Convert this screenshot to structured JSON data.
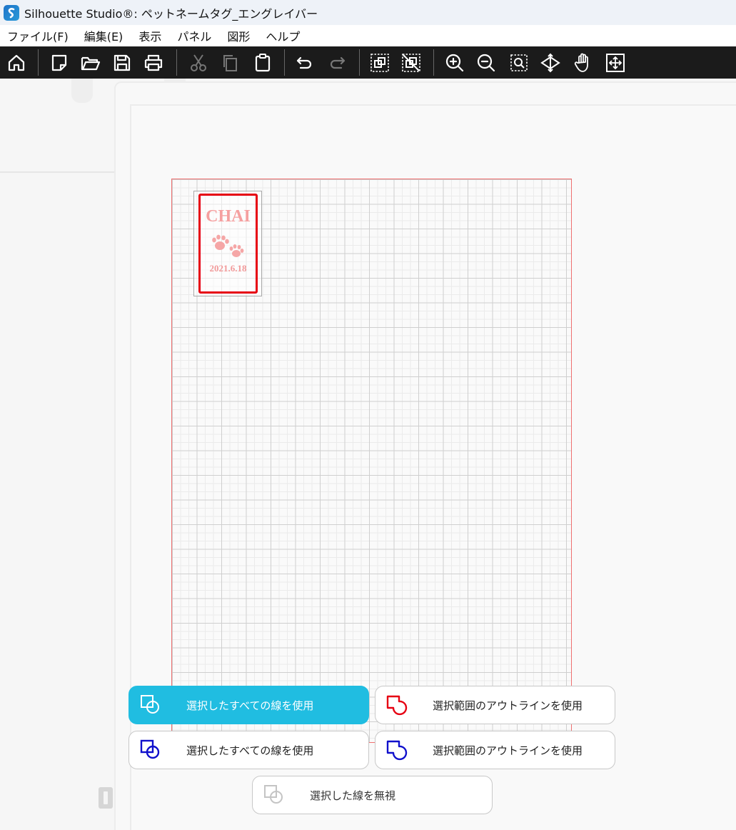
{
  "window": {
    "title": "Silhouette Studio®: ペットネームタグ_エングレイバー"
  },
  "menu": {
    "items": [
      "ファイル(F)",
      "編集(E)",
      "表示",
      "パネル",
      "図形",
      "ヘルプ"
    ]
  },
  "toolbar": {
    "buttons": [
      {
        "name": "home",
        "icon": "home-icon",
        "enabled": true
      },
      {
        "name": "new",
        "icon": "new-document-icon",
        "enabled": true
      },
      {
        "name": "open",
        "icon": "folder-open-icon",
        "enabled": true
      },
      {
        "name": "save",
        "icon": "save-icon",
        "enabled": true
      },
      {
        "name": "print",
        "icon": "printer-icon",
        "enabled": true
      },
      {
        "name": "cut",
        "icon": "scissors-icon",
        "enabled": false
      },
      {
        "name": "copy",
        "icon": "copy-icon",
        "enabled": false
      },
      {
        "name": "paste",
        "icon": "clipboard-icon",
        "enabled": true
      },
      {
        "name": "undo",
        "icon": "undo-icon",
        "enabled": true
      },
      {
        "name": "redo",
        "icon": "redo-icon",
        "enabled": false
      },
      {
        "name": "group",
        "icon": "group-icon",
        "enabled": true
      },
      {
        "name": "ungroup",
        "icon": "ungroup-icon",
        "enabled": true
      },
      {
        "name": "zoom-in",
        "icon": "zoom-in-icon",
        "enabled": true
      },
      {
        "name": "zoom-out",
        "icon": "zoom-out-icon",
        "enabled": true
      },
      {
        "name": "zoom-selection",
        "icon": "zoom-selection-icon",
        "enabled": true
      },
      {
        "name": "drag-zoom",
        "icon": "drag-zoom-icon",
        "enabled": true
      },
      {
        "name": "pan",
        "icon": "hand-icon",
        "enabled": true
      },
      {
        "name": "fit-to-page",
        "icon": "fit-to-page-icon",
        "enabled": true
      }
    ]
  },
  "design": {
    "name_text": "CHAI",
    "date_text": "2021.6.18",
    "paw_icon": "paw-print-icon",
    "text_color": "#f5a0a0",
    "outline_color": "#e60012"
  },
  "options": {
    "use_all_lines_active": "選択したすべての線を使用",
    "use_outline_red": "選択範囲のアウトラインを使用",
    "use_all_lines_blue": "選択したすべての線を使用",
    "use_outline_blue": "選択範囲のアウトラインを使用",
    "ignore_selected": "選択した線を無視"
  },
  "colors": {
    "toolbar_bg": "#1b1b1b",
    "accent": "#20bde1",
    "mat_border": "#ef7070"
  }
}
